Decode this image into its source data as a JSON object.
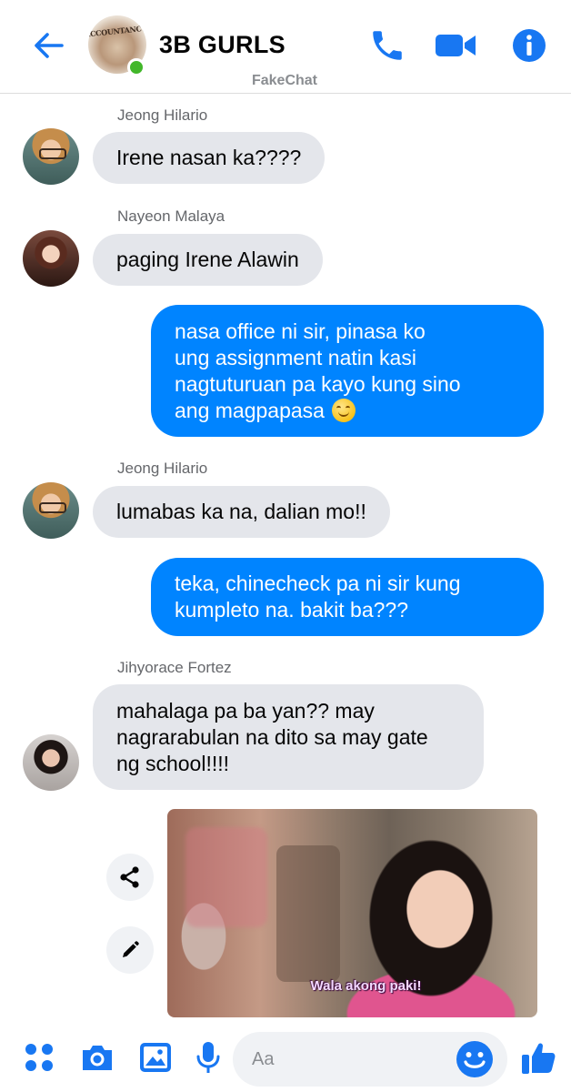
{
  "header": {
    "group_name": "3B GURLS",
    "group_avatar_text": "ACCOUNTANCY",
    "watermark": "FakeChat",
    "online": true
  },
  "messages": [
    {
      "type": "incoming",
      "sender": "Jeong Hilario",
      "lines": [
        "Irene nasan ka????"
      ]
    },
    {
      "type": "incoming",
      "sender": "Nayeon Malaya",
      "lines": [
        "paging Irene Alawin"
      ]
    },
    {
      "type": "outgoing",
      "lines": [
        "nasa office ni sir, pinasa ko",
        "ung assignment natin kasi",
        "nagtuturuan pa kayo kung sino",
        "ang magpapasa"
      ]
    },
    {
      "type": "incoming",
      "sender": "Jeong Hilario",
      "lines": [
        "lumabas ka na, dalian mo!!"
      ]
    },
    {
      "type": "outgoing",
      "lines": [
        "teka, chinecheck pa ni sir kung",
        "kumpleto na. bakit ba???"
      ]
    },
    {
      "type": "incoming",
      "sender": "Jihyorace Fortez",
      "lines": [
        "mahalaga pa ba yan?? may",
        "nagrarabulan na dito sa may gate",
        "ng school!!!!"
      ]
    },
    {
      "type": "image",
      "caption": "Wala akong paki!"
    }
  ],
  "composer": {
    "placeholder": "Aa"
  },
  "colors": {
    "accent": "#0084ff",
    "incoming_bubble": "#e4e6eb",
    "online": "#42b72a"
  },
  "icons": [
    "back-arrow-icon",
    "phone-icon",
    "video-camera-icon",
    "info-icon",
    "share-icon",
    "edit-pencil-icon",
    "apps-grid-icon",
    "camera-icon",
    "gallery-icon",
    "microphone-icon",
    "emoji-icon",
    "thumbs-up-icon"
  ]
}
